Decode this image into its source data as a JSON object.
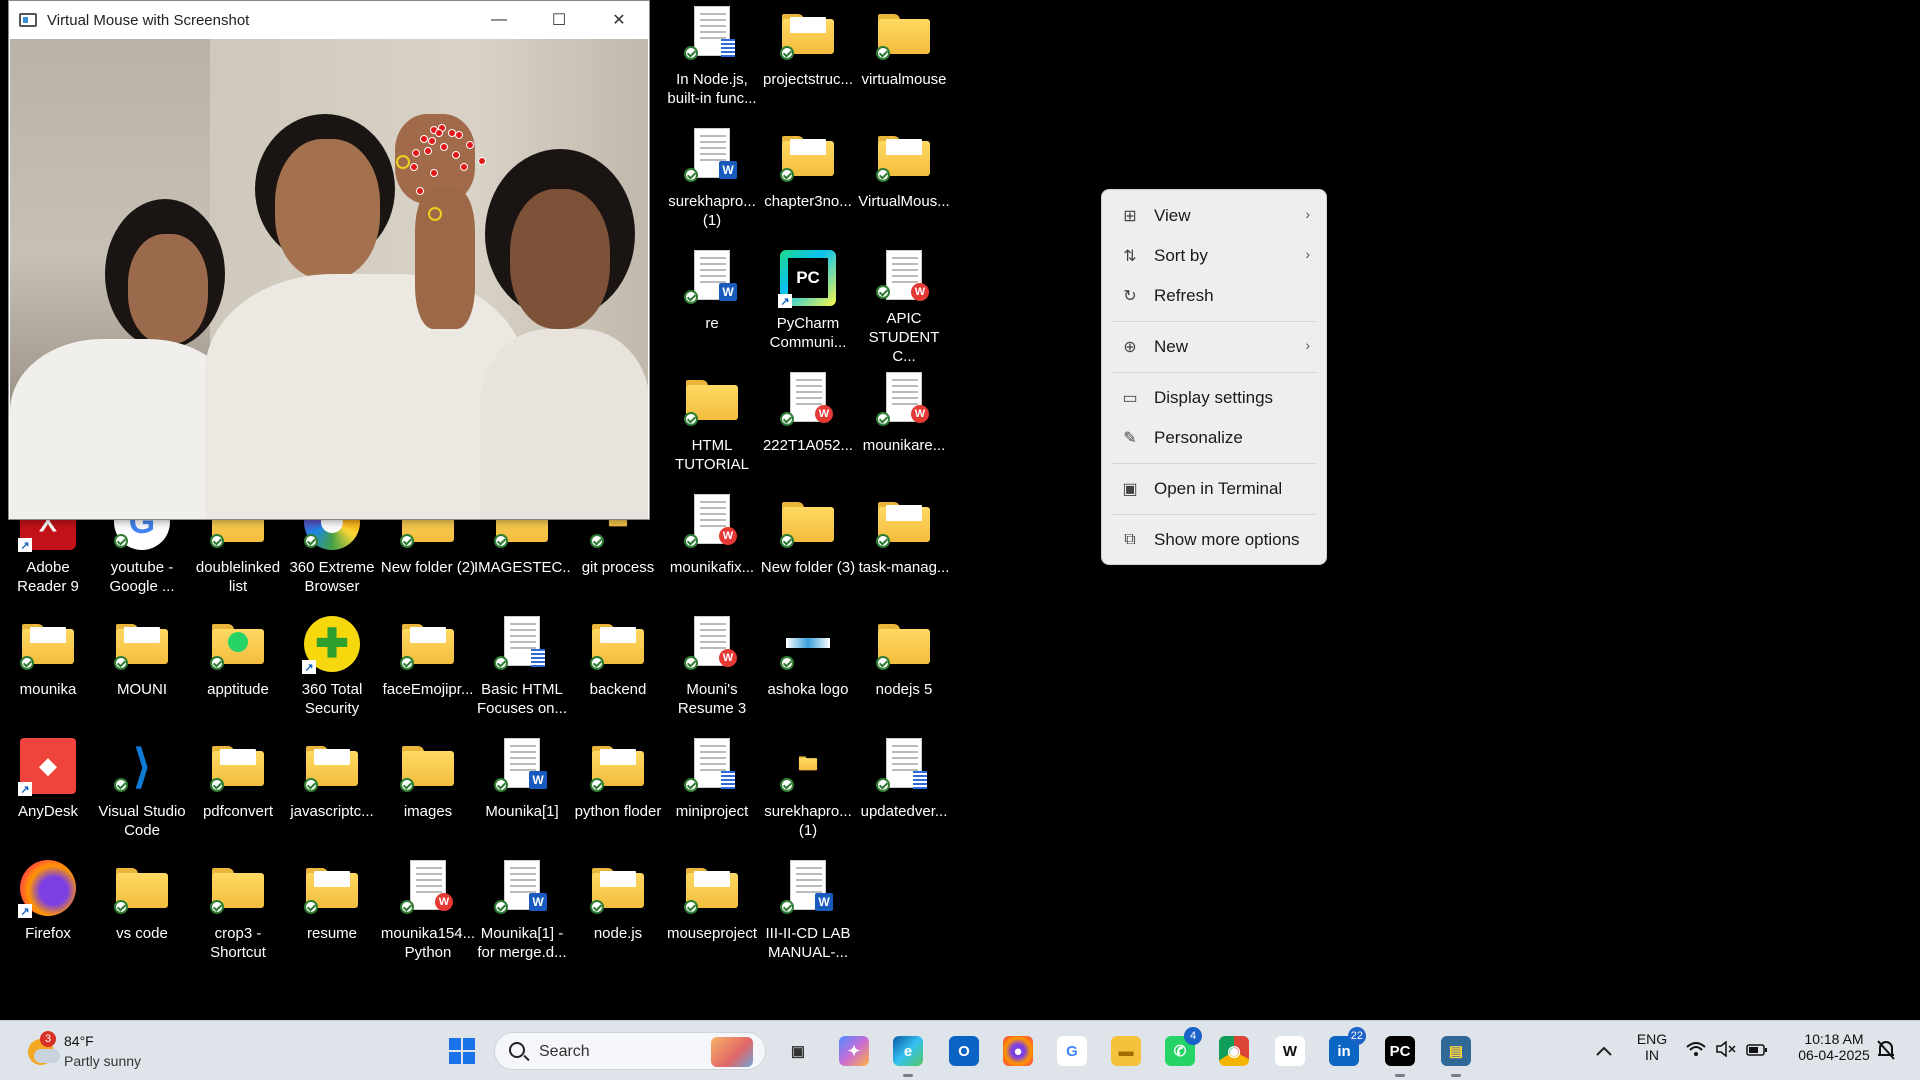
{
  "camera_window": {
    "title": "Virtual Mouse with Screenshot",
    "minimize": "—",
    "maximize": "☐",
    "close": "✕"
  },
  "desktop_icons": [
    {
      "label": "-",
      "type": "dash"
    },
    {
      "label": "In Node.js, built-in func...",
      "type": "doc-notes"
    },
    {
      "label": "projectstruc...",
      "type": "folder-paper"
    },
    {
      "label": "virtualmouse",
      "type": "folder"
    },
    {
      "label": "surekhapro... (1)",
      "type": "doc-w"
    },
    {
      "label": "chapter3no...",
      "type": "folder-paper"
    },
    {
      "label": "VirtualMous...",
      "type": "folder-paper"
    },
    {
      "label": "re",
      "type": "doc-w"
    },
    {
      "label": "PyCharm Communi...",
      "type": "pycharm"
    },
    {
      "label": "APIC STUDENT C...",
      "type": "doc-wps"
    },
    {
      "label": "HTML TUTORIAL",
      "type": "folder"
    },
    {
      "label": "222T1A052...",
      "type": "doc-wps"
    },
    {
      "label": "mounikare...",
      "type": "doc-wps"
    },
    {
      "label": "Adobe Reader 9",
      "type": "adobe"
    },
    {
      "label": "youtube - Google ...",
      "type": "google"
    },
    {
      "label": "doublelinked list",
      "type": "folder"
    },
    {
      "label": "360 Extreme Browser",
      "type": "browser360"
    },
    {
      "label": "New folder (2)",
      "type": "folder"
    },
    {
      "label": "IMAGESTEC...",
      "type": "folder"
    },
    {
      "label": "git process",
      "type": "folder-small"
    },
    {
      "label": "mounikafix...",
      "type": "doc-wps"
    },
    {
      "label": "New folder (3)",
      "type": "folder"
    },
    {
      "label": "task-manag...",
      "type": "folder-paper"
    },
    {
      "label": "mounika",
      "type": "folder-paper"
    },
    {
      "label": "MOUNI",
      "type": "folder-paper"
    },
    {
      "label": "apptitude",
      "type": "folder-wa"
    },
    {
      "label": "360 Total Security",
      "type": "security360"
    },
    {
      "label": "faceEmojipr...",
      "type": "folder-paper"
    },
    {
      "label": "Basic HTML Focuses on...",
      "type": "doc-notes"
    },
    {
      "label": "backend",
      "type": "folder-paper"
    },
    {
      "label": "Mouni's Resume 3",
      "type": "doc-wps"
    },
    {
      "label": "ashoka logo",
      "type": "image-small"
    },
    {
      "label": "nodejs 5",
      "type": "folder"
    },
    {
      "label": "AnyDesk",
      "type": "anydesk"
    },
    {
      "label": "Visual Studio Code",
      "type": "vscode"
    },
    {
      "label": "pdfconvert",
      "type": "folder-paper"
    },
    {
      "label": "javascriptc...",
      "type": "folder-paper"
    },
    {
      "label": "images",
      "type": "folder"
    },
    {
      "label": "Mounika[1]",
      "type": "doc-w"
    },
    {
      "label": "python floder",
      "type": "folder-paper"
    },
    {
      "label": "miniproject",
      "type": "doc-notes"
    },
    {
      "label": "surekhapro... (1)",
      "type": "folder-small"
    },
    {
      "label": "updatedver...",
      "type": "doc-notes"
    },
    {
      "label": "Firefox",
      "type": "firefox"
    },
    {
      "label": "vs code",
      "type": "folder"
    },
    {
      "label": "crop3 - Shortcut",
      "type": "folder"
    },
    {
      "label": "resume",
      "type": "folder-paper"
    },
    {
      "label": "mounika154... Python",
      "type": "doc-wps"
    },
    {
      "label": "Mounika[1] - for merge.d...",
      "type": "doc-w"
    },
    {
      "label": "node.js",
      "type": "folder-paper"
    },
    {
      "label": "mouseproject",
      "type": "folder-paper"
    },
    {
      "label": "III-II-CD LAB MANUAL-...",
      "type": "doc-w"
    }
  ],
  "context_menu": {
    "items": [
      {
        "label": "View",
        "icon": "grid-icon",
        "submenu": true
      },
      {
        "label": "Sort by",
        "icon": "sort-icon",
        "submenu": true
      },
      {
        "label": "Refresh",
        "icon": "refresh-icon",
        "submenu": false
      },
      {
        "label": "New",
        "icon": "plus-circle-icon",
        "submenu": true
      },
      {
        "label": "Display settings",
        "icon": "display-icon",
        "submenu": false
      },
      {
        "label": "Personalize",
        "icon": "brush-icon",
        "submenu": false
      },
      {
        "label": "Open in Terminal",
        "icon": "terminal-icon",
        "submenu": false
      },
      {
        "label": "Show more options",
        "icon": "share-icon",
        "submenu": false
      }
    ]
  },
  "taskbar": {
    "weather": {
      "temp": "84°F",
      "condition": "Partly sunny",
      "notifications": "3"
    },
    "search_placeholder": "Search",
    "apps": [
      {
        "name": "task-view",
        "badge": ""
      },
      {
        "name": "copilot",
        "badge": ""
      },
      {
        "name": "edge",
        "badge": ""
      },
      {
        "name": "outlook",
        "badge": ""
      },
      {
        "name": "firefox",
        "badge": ""
      },
      {
        "name": "google",
        "badge": ""
      },
      {
        "name": "file-explorer",
        "badge": ""
      },
      {
        "name": "whatsapp",
        "badge": "4"
      },
      {
        "name": "chrome",
        "badge": ""
      },
      {
        "name": "wikipedia",
        "badge": ""
      },
      {
        "name": "linkedin",
        "badge": "22"
      },
      {
        "name": "pycharm",
        "badge": ""
      },
      {
        "name": "python-app",
        "badge": ""
      }
    ],
    "language": "ENG",
    "region": "IN",
    "time": "10:18 AM",
    "date": "06-04-2025"
  },
  "colors": {
    "folder": "#f3bd3e",
    "accent": "#1b62c9",
    "taskbar": "#dfe4ea",
    "menu": "#eeeeee"
  }
}
